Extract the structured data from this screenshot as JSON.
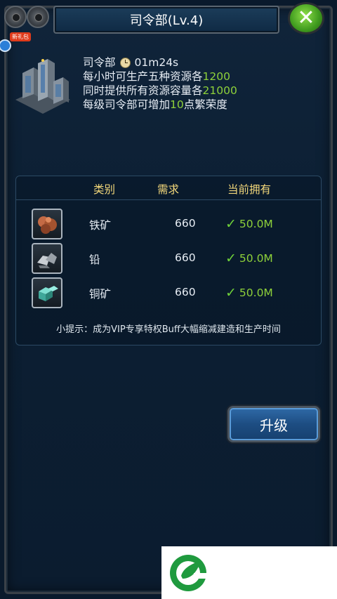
{
  "title": "司令部(Lv.4)",
  "gift_badge": "新礼包",
  "building": {
    "name": "司令部",
    "timer": "01m24s",
    "line1_prefix": "每小时可生产五种资源各",
    "line1_value": "1200",
    "line2_prefix": "同时提供所有资源容量各",
    "line2_value": "21000",
    "line3_prefix": "每级司令部可增加",
    "line3_value": "10",
    "line3_suffix": "点繁荣度"
  },
  "table": {
    "headers": {
      "category": "类别",
      "need": "需求",
      "have": "当前拥有"
    },
    "rows": [
      {
        "name": "铁矿",
        "need": "660",
        "have": "50.0M",
        "icon": "iron-ore-icon"
      },
      {
        "name": "铅",
        "need": "660",
        "have": "50.0M",
        "icon": "lead-ore-icon"
      },
      {
        "name": "铜矿",
        "need": "660",
        "have": "50.0M",
        "icon": "copper-ore-icon"
      }
    ],
    "tip": "小提示：成为VIP专享特权Buff大幅缩减建造和生产时间"
  },
  "upgrade_label": "升级",
  "colors": {
    "accent_green": "#8ed13a",
    "header_gold": "#f2d77a",
    "button_blue": "#1d4d82",
    "close_green": "#3f9a1e"
  }
}
